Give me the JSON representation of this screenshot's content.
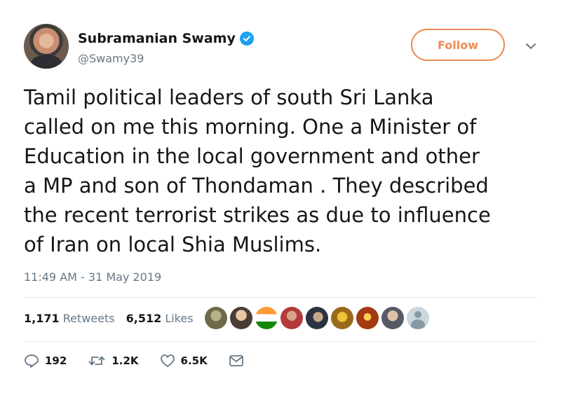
{
  "author": {
    "display_name": "Subramanian Swamy",
    "handle": "@Swamy39",
    "verified": true,
    "avatar_icon": "profile-photo"
  },
  "follow_label": "Follow",
  "accent_color": "#f08a52",
  "tweet_text": "Tamil political leaders of south Sri Lanka\ncalled on me this morning. One a Minister of\nEducation in the local government and other\na MP and son of Thondaman . They described\nthe recent terrorist strikes as due to influence\nof Iran on local Shia Muslims.",
  "timestamp": "11:49 AM - 31 May 2019",
  "stats": {
    "retweets_count": "1,171",
    "retweets_label": "Retweets",
    "likes_count": "6,512",
    "likes_label": "Likes"
  },
  "liker_avatars_count": 9,
  "actions": {
    "reply_count": "192",
    "retweet_count": "1.2K",
    "like_count": "6.5K"
  }
}
